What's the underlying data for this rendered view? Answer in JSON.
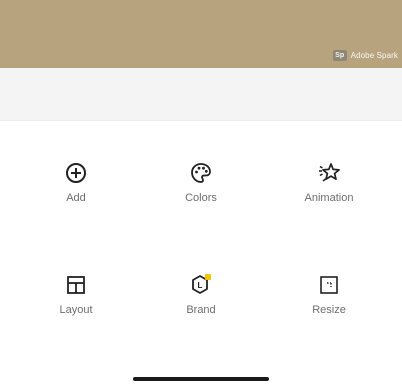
{
  "banner": {
    "brand_logo_text": "Sp",
    "brand_text": "Adobe Spark",
    "background_color": "#b7a47f"
  },
  "tools": [
    {
      "label": "Add",
      "icon": "add-circle-icon"
    },
    {
      "label": "Colors",
      "icon": "palette-icon"
    },
    {
      "label": "Animation",
      "icon": "animation-sparkle-icon"
    },
    {
      "label": "Layout",
      "icon": "layout-grid-icon"
    },
    {
      "label": "Brand",
      "icon": "brand-hexagon-icon",
      "badge_color": "#f5c400"
    },
    {
      "label": "Resize",
      "icon": "resize-frame-icon"
    }
  ]
}
